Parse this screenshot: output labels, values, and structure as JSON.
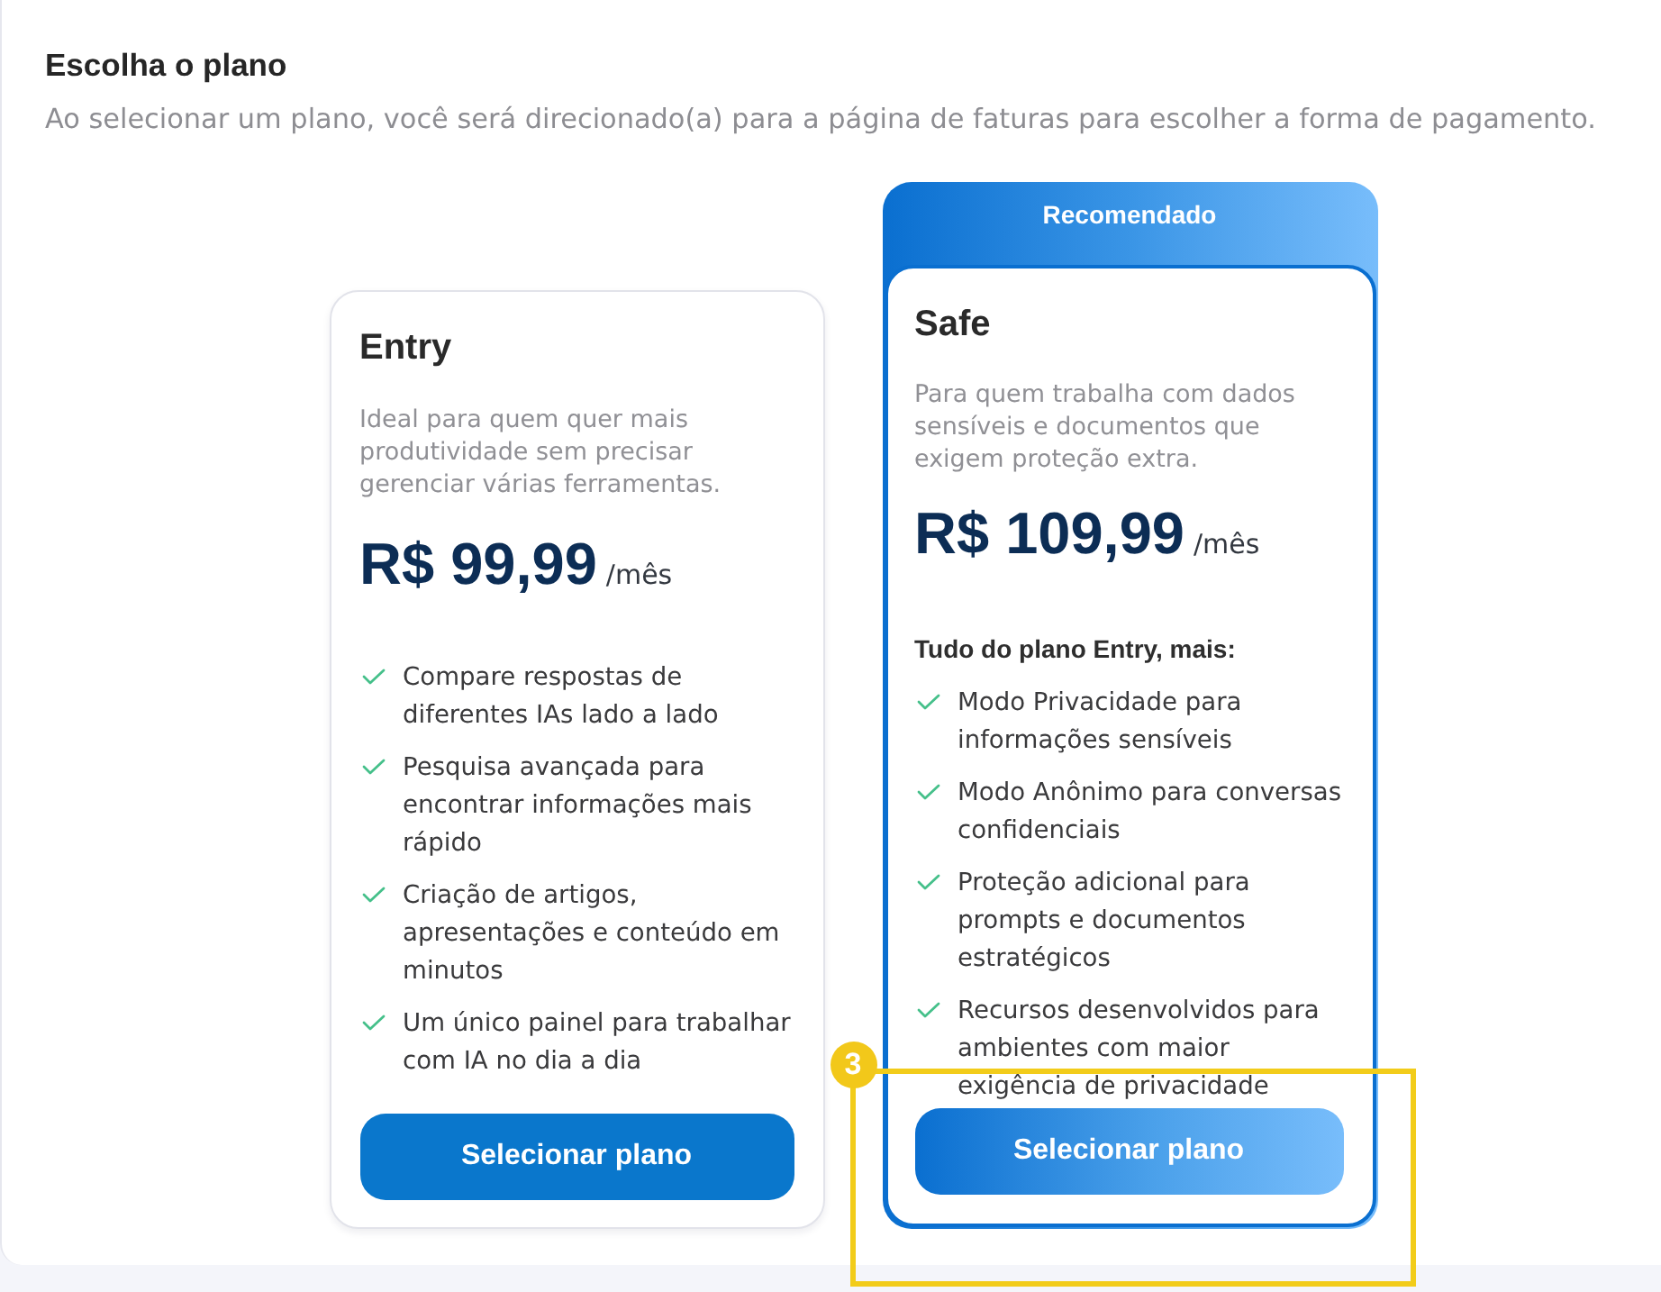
{
  "header": {
    "title": "Escolha o plano",
    "subtitle": "Ao selecionar um plano, você será direcionado(a) para a página de faturas para escolher a forma de pagamento."
  },
  "plans": [
    {
      "name": "Entry",
      "recommended": false,
      "description": "Ideal para quem quer mais produtividade sem precisar gerenciar várias ferramentas.",
      "price": "R$ 99,99",
      "period": "/mês",
      "features": [
        "Compare respostas de diferentes IAs lado a lado",
        "Pesquisa avançada para encontrar informações mais rápido",
        "Criação de artigos, apresentações e conteúdo em minutos",
        "Um único painel para trabalhar com IA no dia a dia"
      ],
      "button": "Selecionar plano"
    },
    {
      "name": "Safe",
      "recommended": true,
      "ribbon": "Recomendado",
      "description": "Para quem trabalha com dados sensíveis e documentos que exigem proteção extra.",
      "price": "R$ 109,99",
      "period": "/mês",
      "features_intro": "Tudo do plano Entry, mais:",
      "features": [
        "Modo Privacidade para informações sensíveis",
        "Modo Anônimo para conversas confidenciais",
        "Proteção adicional para prompts e documentos estratégicos",
        "Recursos desenvolvidos para ambientes com maior exigência de privacidade"
      ],
      "button": "Selecionar plano",
      "callout": "3"
    }
  ]
}
